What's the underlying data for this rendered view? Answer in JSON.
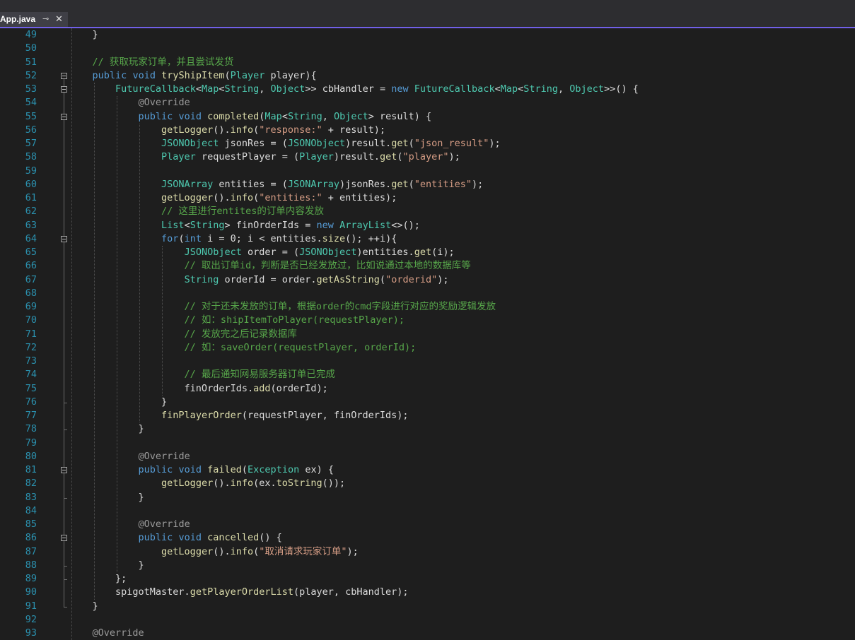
{
  "tab": {
    "file_name": "App.java",
    "pin_glyph": "⊸",
    "close_glyph": "✕"
  },
  "lines": [
    {
      "n": "49",
      "tokens": [
        {
          "t": "    }",
          "c": "tx"
        }
      ]
    },
    {
      "n": "50",
      "tokens": []
    },
    {
      "n": "51",
      "tokens": [
        {
          "t": "    // 获取玩家订单，并且尝试发货",
          "c": "cm"
        }
      ]
    },
    {
      "n": "52",
      "tokens": [
        {
          "t": "    ",
          "c": "tx"
        },
        {
          "t": "public",
          "c": "kw"
        },
        {
          "t": " ",
          "c": "tx"
        },
        {
          "t": "void",
          "c": "kw"
        },
        {
          "t": " ",
          "c": "tx"
        },
        {
          "t": "tryShipItem",
          "c": "fn"
        },
        {
          "t": "(",
          "c": "tx"
        },
        {
          "t": "Player",
          "c": "ty"
        },
        {
          "t": " player){",
          "c": "tx"
        }
      ]
    },
    {
      "n": "53",
      "tokens": [
        {
          "t": "        ",
          "c": "tx"
        },
        {
          "t": "FutureCallback",
          "c": "ty"
        },
        {
          "t": "<",
          "c": "tx"
        },
        {
          "t": "Map",
          "c": "ty"
        },
        {
          "t": "<",
          "c": "tx"
        },
        {
          "t": "String",
          "c": "ty"
        },
        {
          "t": ", ",
          "c": "tx"
        },
        {
          "t": "Object",
          "c": "ty"
        },
        {
          "t": ">> cbHandler = ",
          "c": "tx"
        },
        {
          "t": "new",
          "c": "kw"
        },
        {
          "t": " ",
          "c": "tx"
        },
        {
          "t": "FutureCallback",
          "c": "ty"
        },
        {
          "t": "<",
          "c": "tx"
        },
        {
          "t": "Map",
          "c": "ty"
        },
        {
          "t": "<",
          "c": "tx"
        },
        {
          "t": "String",
          "c": "ty"
        },
        {
          "t": ", ",
          "c": "tx"
        },
        {
          "t": "Object",
          "c": "ty"
        },
        {
          "t": ">>() {",
          "c": "tx"
        }
      ]
    },
    {
      "n": "54",
      "tokens": [
        {
          "t": "            ",
          "c": "tx"
        },
        {
          "t": "@Override",
          "c": "an"
        }
      ]
    },
    {
      "n": "55",
      "tokens": [
        {
          "t": "            ",
          "c": "tx"
        },
        {
          "t": "public",
          "c": "kw"
        },
        {
          "t": " ",
          "c": "tx"
        },
        {
          "t": "void",
          "c": "kw"
        },
        {
          "t": " ",
          "c": "tx"
        },
        {
          "t": "completed",
          "c": "fn"
        },
        {
          "t": "(",
          "c": "tx"
        },
        {
          "t": "Map",
          "c": "ty"
        },
        {
          "t": "<",
          "c": "tx"
        },
        {
          "t": "String",
          "c": "ty"
        },
        {
          "t": ", ",
          "c": "tx"
        },
        {
          "t": "Object",
          "c": "ty"
        },
        {
          "t": "> result) {",
          "c": "tx"
        }
      ]
    },
    {
      "n": "56",
      "tokens": [
        {
          "t": "                ",
          "c": "tx"
        },
        {
          "t": "getLogger",
          "c": "fn"
        },
        {
          "t": "().",
          "c": "tx"
        },
        {
          "t": "info",
          "c": "fn"
        },
        {
          "t": "(",
          "c": "tx"
        },
        {
          "t": "\"response:\"",
          "c": "st"
        },
        {
          "t": " + result);",
          "c": "tx"
        }
      ]
    },
    {
      "n": "57",
      "tokens": [
        {
          "t": "                ",
          "c": "tx"
        },
        {
          "t": "JSONObject",
          "c": "ty"
        },
        {
          "t": " jsonRes = (",
          "c": "tx"
        },
        {
          "t": "JSONObject",
          "c": "ty"
        },
        {
          "t": ")result.",
          "c": "tx"
        },
        {
          "t": "get",
          "c": "fn"
        },
        {
          "t": "(",
          "c": "tx"
        },
        {
          "t": "\"json_result\"",
          "c": "st"
        },
        {
          "t": ");",
          "c": "tx"
        }
      ]
    },
    {
      "n": "58",
      "tokens": [
        {
          "t": "                ",
          "c": "tx"
        },
        {
          "t": "Player",
          "c": "ty"
        },
        {
          "t": " requestPlayer = (",
          "c": "tx"
        },
        {
          "t": "Player",
          "c": "ty"
        },
        {
          "t": ")result.",
          "c": "tx"
        },
        {
          "t": "get",
          "c": "fn"
        },
        {
          "t": "(",
          "c": "tx"
        },
        {
          "t": "\"player\"",
          "c": "st"
        },
        {
          "t": ");",
          "c": "tx"
        }
      ]
    },
    {
      "n": "59",
      "tokens": []
    },
    {
      "n": "60",
      "tokens": [
        {
          "t": "                ",
          "c": "tx"
        },
        {
          "t": "JSONArray",
          "c": "ty"
        },
        {
          "t": " entities = (",
          "c": "tx"
        },
        {
          "t": "JSONArray",
          "c": "ty"
        },
        {
          "t": ")jsonRes.",
          "c": "tx"
        },
        {
          "t": "get",
          "c": "fn"
        },
        {
          "t": "(",
          "c": "tx"
        },
        {
          "t": "\"entities\"",
          "c": "st"
        },
        {
          "t": ");",
          "c": "tx"
        }
      ]
    },
    {
      "n": "61",
      "tokens": [
        {
          "t": "                ",
          "c": "tx"
        },
        {
          "t": "getLogger",
          "c": "fn"
        },
        {
          "t": "().",
          "c": "tx"
        },
        {
          "t": "info",
          "c": "fn"
        },
        {
          "t": "(",
          "c": "tx"
        },
        {
          "t": "\"entities:\"",
          "c": "st"
        },
        {
          "t": " + entities);",
          "c": "tx"
        }
      ]
    },
    {
      "n": "62",
      "tokens": [
        {
          "t": "                // 这里进行entites的订单内容发放",
          "c": "cm"
        }
      ]
    },
    {
      "n": "63",
      "tokens": [
        {
          "t": "                ",
          "c": "tx"
        },
        {
          "t": "List",
          "c": "ty"
        },
        {
          "t": "<",
          "c": "tx"
        },
        {
          "t": "String",
          "c": "ty"
        },
        {
          "t": "> finOrderIds = ",
          "c": "tx"
        },
        {
          "t": "new",
          "c": "kw"
        },
        {
          "t": " ",
          "c": "tx"
        },
        {
          "t": "ArrayList",
          "c": "ty"
        },
        {
          "t": "<>();",
          "c": "tx"
        }
      ]
    },
    {
      "n": "64",
      "tokens": [
        {
          "t": "                ",
          "c": "tx"
        },
        {
          "t": "for",
          "c": "kw"
        },
        {
          "t": "(",
          "c": "tx"
        },
        {
          "t": "int",
          "c": "kw"
        },
        {
          "t": " i = 0; i < entities.",
          "c": "tx"
        },
        {
          "t": "size",
          "c": "fn"
        },
        {
          "t": "(); ++i){",
          "c": "tx"
        }
      ]
    },
    {
      "n": "65",
      "tokens": [
        {
          "t": "                    ",
          "c": "tx"
        },
        {
          "t": "JSONObject",
          "c": "ty"
        },
        {
          "t": " order = (",
          "c": "tx"
        },
        {
          "t": "JSONObject",
          "c": "ty"
        },
        {
          "t": ")entities.",
          "c": "tx"
        },
        {
          "t": "get",
          "c": "fn"
        },
        {
          "t": "(i);",
          "c": "tx"
        }
      ]
    },
    {
      "n": "66",
      "tokens": [
        {
          "t": "                    // 取出订单id，判断是否已经发放过，比如说通过本地的数据库等",
          "c": "cm"
        }
      ]
    },
    {
      "n": "67",
      "tokens": [
        {
          "t": "                    ",
          "c": "tx"
        },
        {
          "t": "String",
          "c": "ty"
        },
        {
          "t": " orderId = order.",
          "c": "tx"
        },
        {
          "t": "getAsString",
          "c": "fn"
        },
        {
          "t": "(",
          "c": "tx"
        },
        {
          "t": "\"orderid\"",
          "c": "st"
        },
        {
          "t": ");",
          "c": "tx"
        }
      ]
    },
    {
      "n": "68",
      "tokens": []
    },
    {
      "n": "69",
      "tokens": [
        {
          "t": "                    // 对于还未发放的订单，根据order的cmd字段进行对应的奖励逻辑发放",
          "c": "cm"
        }
      ]
    },
    {
      "n": "70",
      "tokens": [
        {
          "t": "                    // 如：shipItemToPlayer(requestPlayer);",
          "c": "cm"
        }
      ]
    },
    {
      "n": "71",
      "tokens": [
        {
          "t": "                    // 发放完之后记录数据库",
          "c": "cm"
        }
      ]
    },
    {
      "n": "72",
      "tokens": [
        {
          "t": "                    // 如：saveOrder(requestPlayer, orderId);",
          "c": "cm"
        }
      ]
    },
    {
      "n": "73",
      "tokens": []
    },
    {
      "n": "74",
      "tokens": [
        {
          "t": "                    // 最后通知网易服务器订单已完成",
          "c": "cm"
        }
      ]
    },
    {
      "n": "75",
      "tokens": [
        {
          "t": "                    finOrderIds.",
          "c": "tx"
        },
        {
          "t": "add",
          "c": "fn"
        },
        {
          "t": "(orderId);",
          "c": "tx"
        }
      ]
    },
    {
      "n": "76",
      "tokens": [
        {
          "t": "                }",
          "c": "tx"
        }
      ]
    },
    {
      "n": "77",
      "tokens": [
        {
          "t": "                ",
          "c": "tx"
        },
        {
          "t": "finPlayerOrder",
          "c": "fn"
        },
        {
          "t": "(requestPlayer, finOrderIds);",
          "c": "tx"
        }
      ]
    },
    {
      "n": "78",
      "tokens": [
        {
          "t": "            }",
          "c": "tx"
        }
      ]
    },
    {
      "n": "79",
      "tokens": []
    },
    {
      "n": "80",
      "tokens": [
        {
          "t": "            ",
          "c": "tx"
        },
        {
          "t": "@Override",
          "c": "an"
        }
      ]
    },
    {
      "n": "81",
      "tokens": [
        {
          "t": "            ",
          "c": "tx"
        },
        {
          "t": "public",
          "c": "kw"
        },
        {
          "t": " ",
          "c": "tx"
        },
        {
          "t": "void",
          "c": "kw"
        },
        {
          "t": " ",
          "c": "tx"
        },
        {
          "t": "failed",
          "c": "fn"
        },
        {
          "t": "(",
          "c": "tx"
        },
        {
          "t": "Exception",
          "c": "ty"
        },
        {
          "t": " ex) {",
          "c": "tx"
        }
      ]
    },
    {
      "n": "82",
      "tokens": [
        {
          "t": "                ",
          "c": "tx"
        },
        {
          "t": "getLogger",
          "c": "fn"
        },
        {
          "t": "().",
          "c": "tx"
        },
        {
          "t": "info",
          "c": "fn"
        },
        {
          "t": "(ex.",
          "c": "tx"
        },
        {
          "t": "toString",
          "c": "fn"
        },
        {
          "t": "());",
          "c": "tx"
        }
      ]
    },
    {
      "n": "83",
      "tokens": [
        {
          "t": "            }",
          "c": "tx"
        }
      ]
    },
    {
      "n": "84",
      "tokens": []
    },
    {
      "n": "85",
      "tokens": [
        {
          "t": "            ",
          "c": "tx"
        },
        {
          "t": "@Override",
          "c": "an"
        }
      ]
    },
    {
      "n": "86",
      "tokens": [
        {
          "t": "            ",
          "c": "tx"
        },
        {
          "t": "public",
          "c": "kw"
        },
        {
          "t": " ",
          "c": "tx"
        },
        {
          "t": "void",
          "c": "kw"
        },
        {
          "t": " ",
          "c": "tx"
        },
        {
          "t": "cancelled",
          "c": "fn"
        },
        {
          "t": "() {",
          "c": "tx"
        }
      ]
    },
    {
      "n": "87",
      "tokens": [
        {
          "t": "                ",
          "c": "tx"
        },
        {
          "t": "getLogger",
          "c": "fn"
        },
        {
          "t": "().",
          "c": "tx"
        },
        {
          "t": "info",
          "c": "fn"
        },
        {
          "t": "(",
          "c": "tx"
        },
        {
          "t": "\"取消请求玩家订单\"",
          "c": "st"
        },
        {
          "t": ");",
          "c": "tx"
        }
      ]
    },
    {
      "n": "88",
      "tokens": [
        {
          "t": "            }",
          "c": "tx"
        }
      ]
    },
    {
      "n": "89",
      "tokens": [
        {
          "t": "        };",
          "c": "tx"
        }
      ]
    },
    {
      "n": "90",
      "tokens": [
        {
          "t": "        spigotMaster.",
          "c": "tx"
        },
        {
          "t": "getPlayerOrderList",
          "c": "fn"
        },
        {
          "t": "(player, cbHandler);",
          "c": "tx"
        }
      ]
    },
    {
      "n": "91",
      "tokens": [
        {
          "t": "    }",
          "c": "tx"
        }
      ]
    },
    {
      "n": "92",
      "tokens": []
    },
    {
      "n": "93",
      "tokens": [
        {
          "t": "    ",
          "c": "tx"
        },
        {
          "t": "@Override",
          "c": "an"
        }
      ]
    }
  ]
}
